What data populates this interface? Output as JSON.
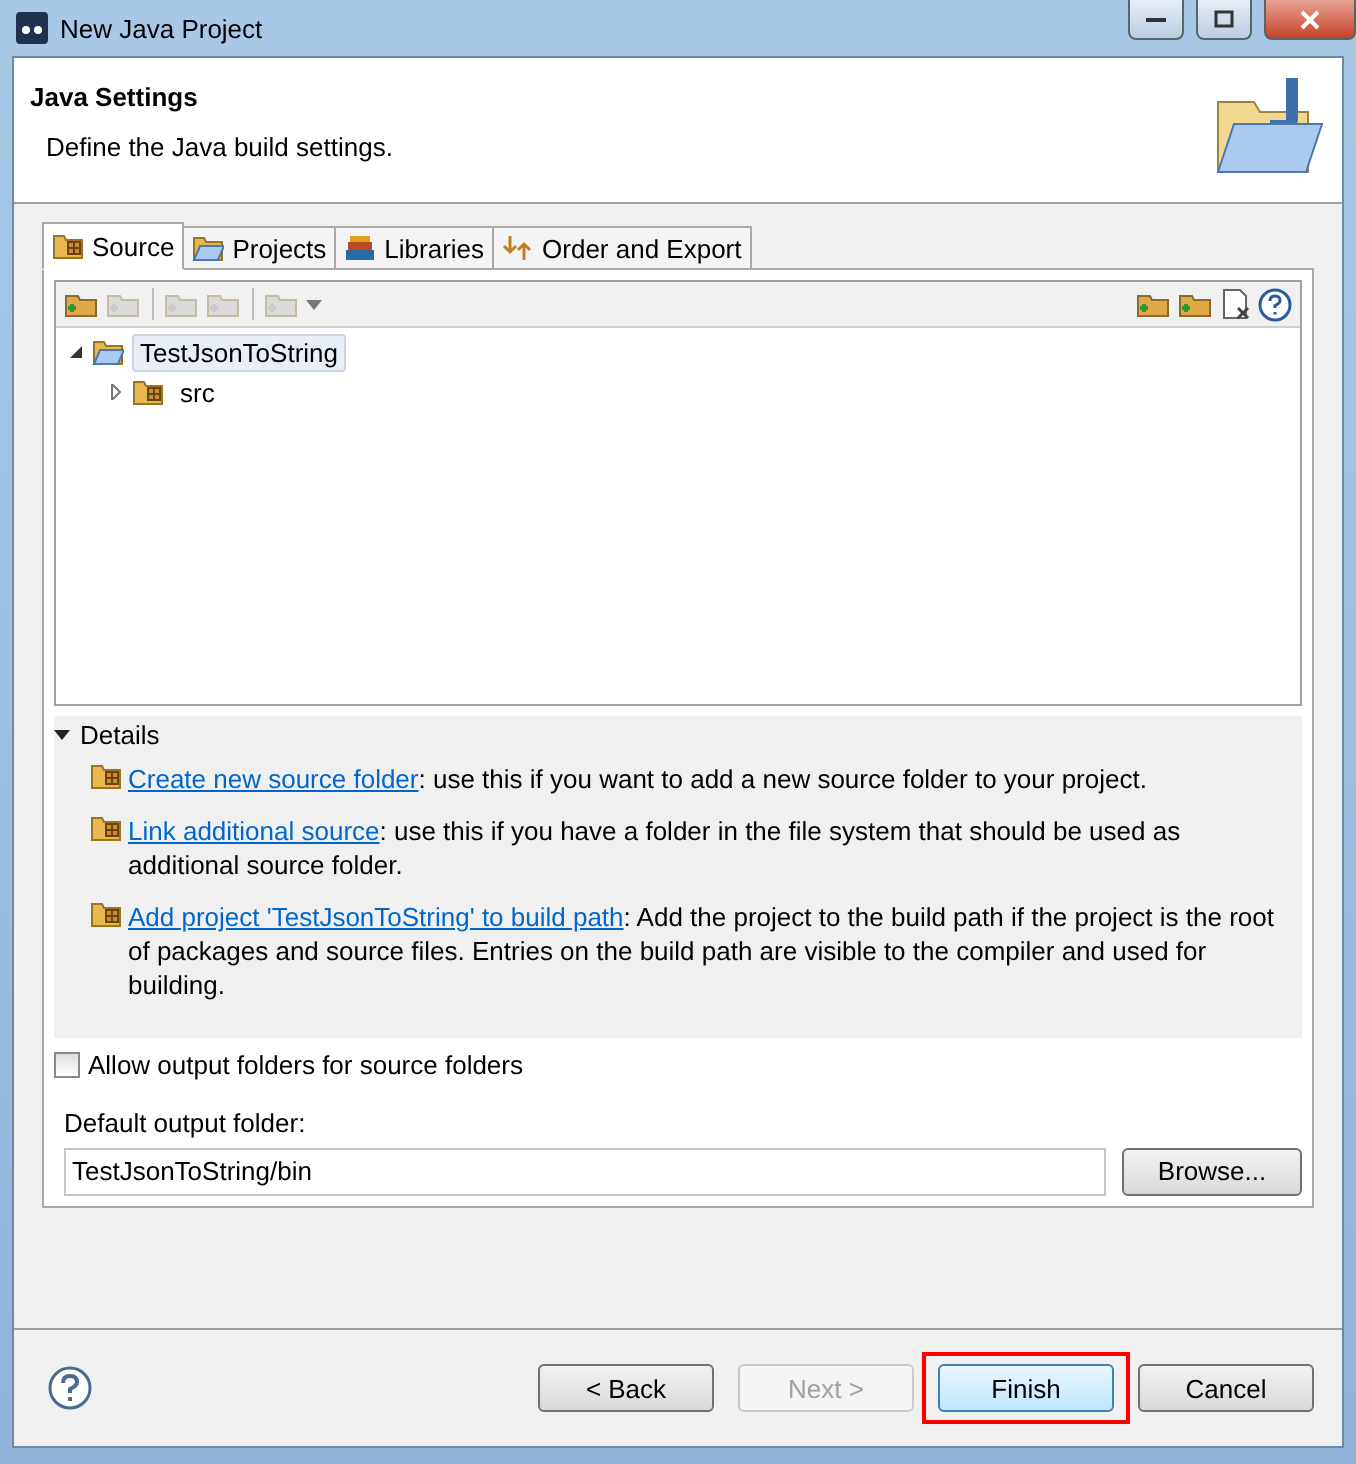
{
  "window": {
    "title": "New Java Project"
  },
  "banner": {
    "title": "Java Settings",
    "description": "Define the Java build settings."
  },
  "tabs": [
    {
      "label": "Source",
      "selected": true
    },
    {
      "label": "Projects",
      "selected": false
    },
    {
      "label": "Libraries",
      "selected": false
    },
    {
      "label": "Order and Export",
      "selected": false
    }
  ],
  "toolbar_left": [
    {
      "disabled": false
    },
    {
      "disabled": true
    },
    {
      "disabled": true
    },
    {
      "disabled": true
    },
    {
      "disabled": true
    }
  ],
  "tree": [
    {
      "label": "TestJsonToString",
      "expanded": true,
      "selected": true,
      "children": [
        {
          "label": "src",
          "expanded": false,
          "selected": false
        }
      ]
    }
  ],
  "details": {
    "label": "Details",
    "expanded": true,
    "items": [
      {
        "link": "Create new source folder",
        "text": ": use this if you want to add a new source folder to your project."
      },
      {
        "link": "Link additional source",
        "text": ": use this if you have a folder in the file system that should be used as additional source folder."
      },
      {
        "link": "Add project 'TestJsonToString' to build path",
        "text": ": Add the project to the build path if the project is the root of packages and source files. Entries on the build path are visible to the compiler and used for building."
      }
    ]
  },
  "allow_output": {
    "label": "Allow output folders for source folders",
    "checked": false
  },
  "output_folder": {
    "label": "Default output folder:",
    "value": "TestJsonToString/bin"
  },
  "browse_button": "Browse...",
  "buttons": [
    {
      "label": "< Back",
      "disabled": false,
      "default": false,
      "highlighted": false
    },
    {
      "label": "Next >",
      "disabled": true,
      "default": false,
      "highlighted": false
    },
    {
      "label": "Finish",
      "disabled": false,
      "default": true,
      "highlighted": true
    },
    {
      "label": "Cancel",
      "disabled": false,
      "default": false,
      "highlighted": false
    }
  ]
}
